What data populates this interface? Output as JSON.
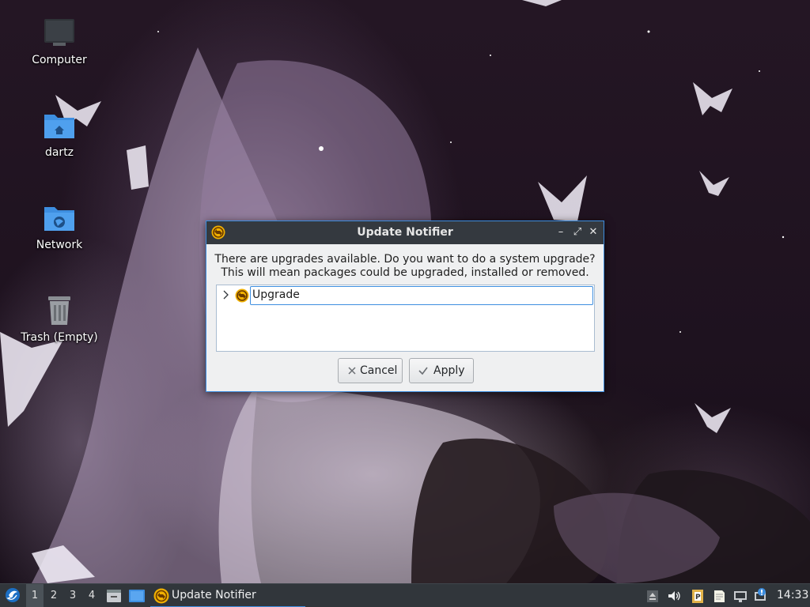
{
  "desktop": {
    "icons": [
      {
        "label": "Computer",
        "icon": "computer-icon"
      },
      {
        "label": "dartz",
        "icon": "home-folder-icon"
      },
      {
        "label": "Network",
        "icon": "network-folder-icon"
      },
      {
        "label": "Trash (Empty)",
        "icon": "trash-icon"
      }
    ]
  },
  "dialog": {
    "title": "Update Notifier",
    "icon": "update-notifier-icon",
    "message_line1": "There are upgrades available. Do you want to do a system upgrade?",
    "message_line2": "This will mean packages could be upgraded, installed or removed.",
    "tree": {
      "items": [
        {
          "label": "Upgrade",
          "expanded": false,
          "icon": "update-icon"
        }
      ]
    },
    "buttons": {
      "cancel_label": "Cancel",
      "apply_label": "Apply"
    },
    "titlebar_buttons": [
      "minimize-icon",
      "maximize-icon",
      "close-icon"
    ]
  },
  "taskbar": {
    "workspaces": [
      "1",
      "2",
      "3",
      "4"
    ],
    "active_workspace": "1",
    "task_label": "Update Notifier",
    "clock": "14:33",
    "tray_icons": [
      "eject-icon",
      "volume-icon",
      "clipboard-icon",
      "notes-icon",
      "network-icon",
      "update-tray-icon"
    ]
  },
  "colors": {
    "accent": "#3d8ee0",
    "titlebar": "#34393f",
    "taskbar": "#31363b",
    "dialog_bg": "#eff0f1"
  }
}
